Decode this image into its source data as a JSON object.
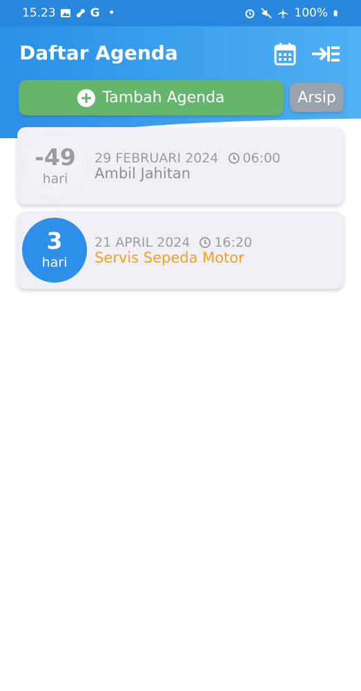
{
  "status_bar": {
    "time": "15.23",
    "g_letter": "G",
    "dot": "•",
    "battery": "100%"
  },
  "header": {
    "title": "Daftar Agenda",
    "calendar_icon": "calendar-icon",
    "login_icon": "arrow-right-list-icon"
  },
  "actions": {
    "add_label": "Tambah Agenda",
    "archive_label": "Arsip"
  },
  "agenda": [
    {
      "days": "-49",
      "unit": "hari",
      "date": "29 FEBRUARI 2024",
      "time": "06:00",
      "title": "Ambil Jahitan",
      "badge_color": "#f2f1f6",
      "days_color": "#9c9ca0",
      "title_color": "#8f8f93"
    },
    {
      "days": "3",
      "unit": "hari",
      "date": "21 APRIL 2024",
      "time": "16:20",
      "title": "Servis Sepeda Motor",
      "badge_color": "#2d8fe8",
      "days_color": "#ffffff",
      "title_color": "#f5a316"
    }
  ]
}
